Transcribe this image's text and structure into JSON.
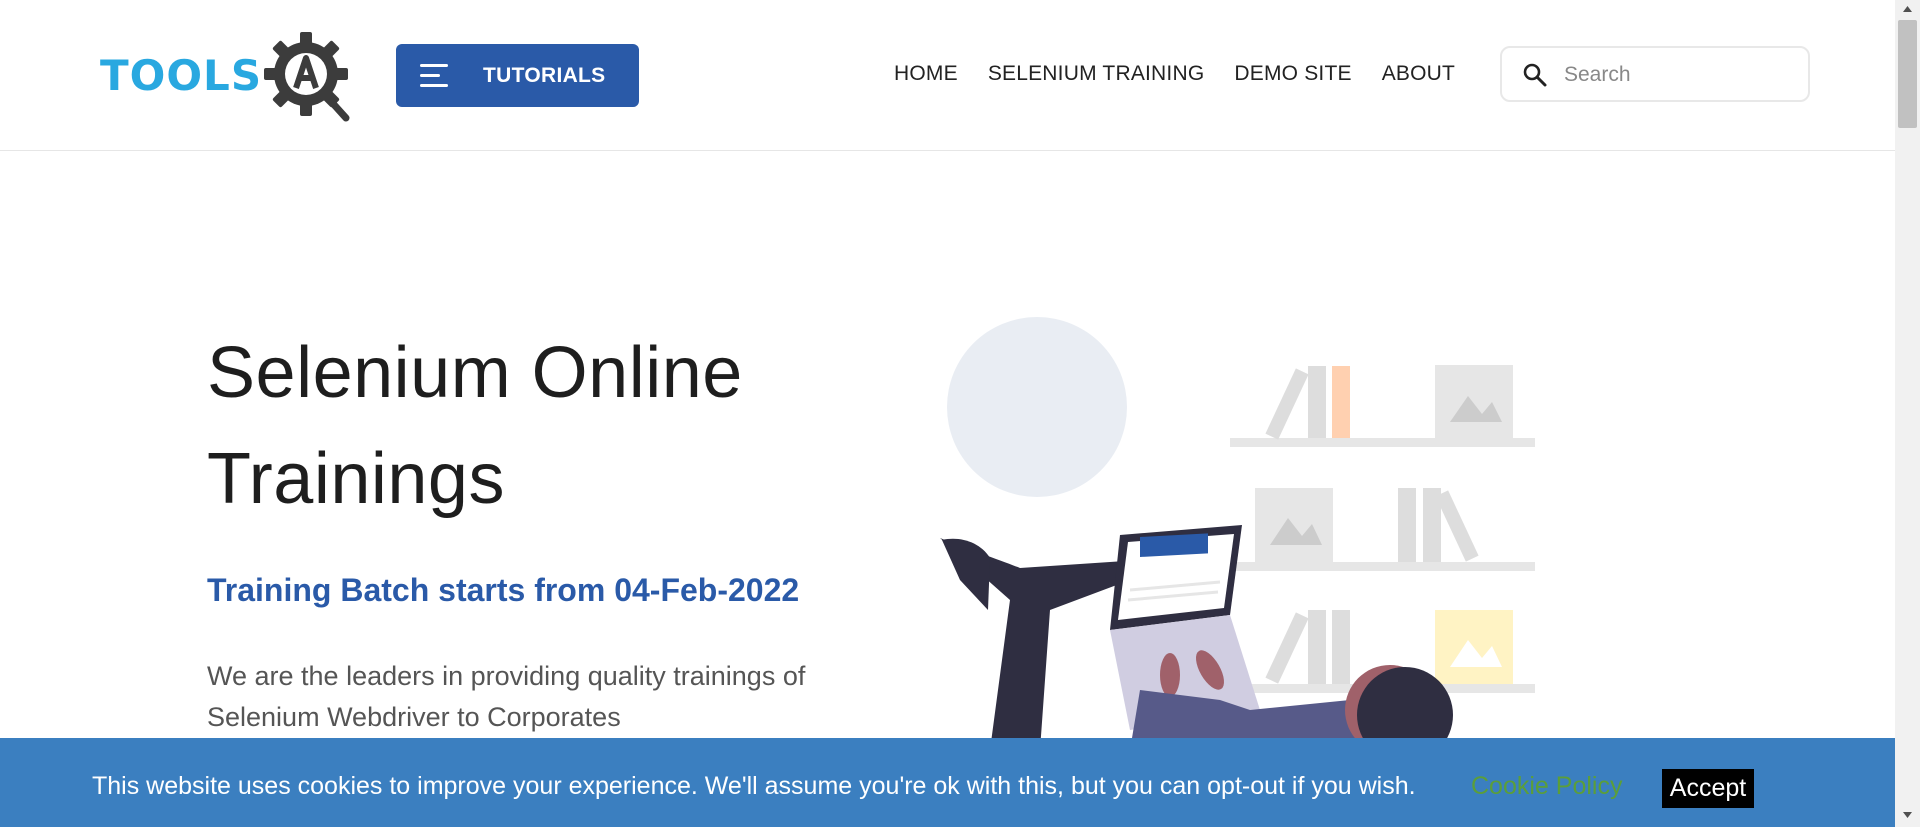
{
  "header": {
    "logo_text": "TOOLS",
    "logo_badge": "A",
    "tutorials_label": "TUTORIALS",
    "nav": [
      {
        "label": "HOME"
      },
      {
        "label": "SELENIUM TRAINING"
      },
      {
        "label": "DEMO SITE"
      },
      {
        "label": "ABOUT"
      }
    ],
    "search_placeholder": "Search"
  },
  "hero": {
    "title_line1": "Selenium Online",
    "title_line2": "Trainings",
    "batch": "Training Batch starts from 04-Feb-2022",
    "description": "We are the leaders in providing quality trainings of Selenium Webdriver to Corporates"
  },
  "cookie": {
    "message": "This website uses cookies to improve your experience. We'll assume you're ok with this, but you can opt-out if you wish.",
    "policy_link": "Cookie Policy",
    "accept_label": "Accept"
  },
  "colors": {
    "brand_blue": "#2a5aa8",
    "logo_blue": "#29a8e0",
    "cookie_bar": "#3b7fc0",
    "cookie_link": "#5b9e3a"
  },
  "icons": {
    "menu": "hamburger-icon",
    "search": "search-icon",
    "logo": "gear-icon"
  }
}
